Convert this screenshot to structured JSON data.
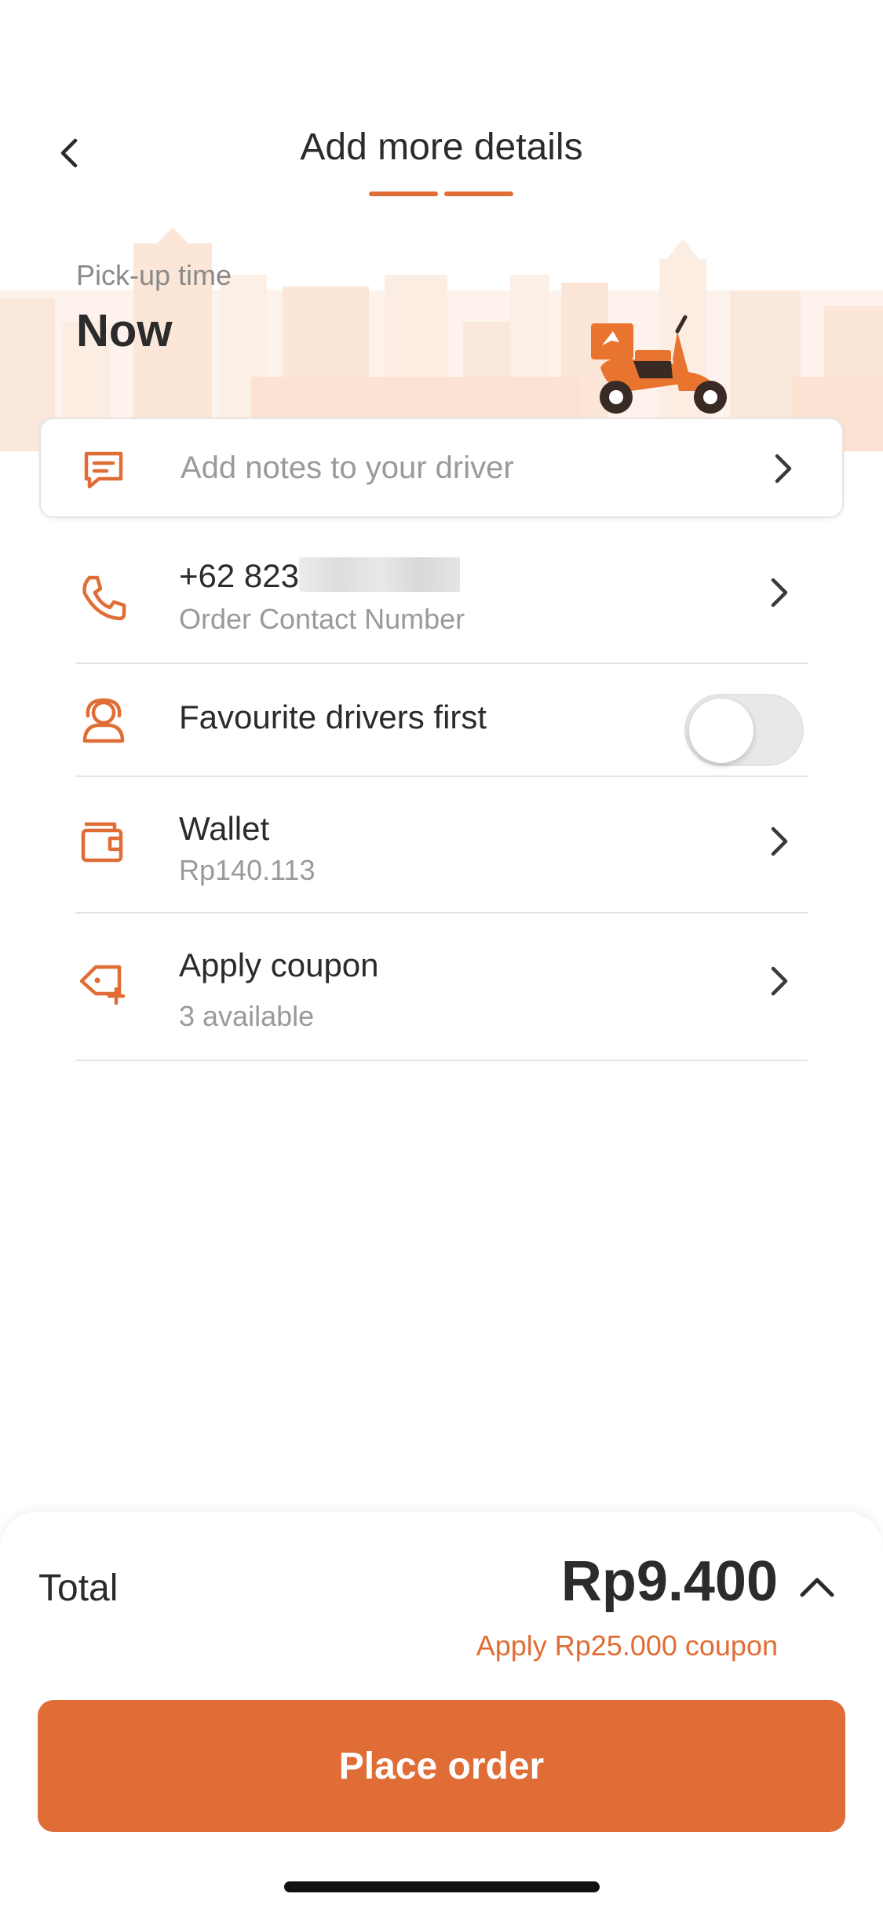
{
  "header": {
    "title": "Add more details",
    "progress_steps": 2,
    "accent_color": "#e06d35"
  },
  "pickup": {
    "label": "Pick-up time",
    "value": "Now"
  },
  "notes": {
    "placeholder": "Add notes to your driver",
    "icon": "message-icon"
  },
  "contact": {
    "number_prefix": "+62 823",
    "label": "Order Contact Number",
    "icon": "phone-icon"
  },
  "favourite_drivers": {
    "label": "Favourite drivers first",
    "enabled": false,
    "icon": "driver-icon"
  },
  "wallet": {
    "label": "Wallet",
    "balance": "Rp140.113",
    "icon": "wallet-icon"
  },
  "coupon": {
    "label": "Apply coupon",
    "available": "3 available",
    "icon": "coupon-icon"
  },
  "summary": {
    "total_label": "Total",
    "total_amount": "Rp9.400",
    "coupon_hint": "Apply Rp25.000 coupon",
    "place_order_label": "Place order"
  }
}
